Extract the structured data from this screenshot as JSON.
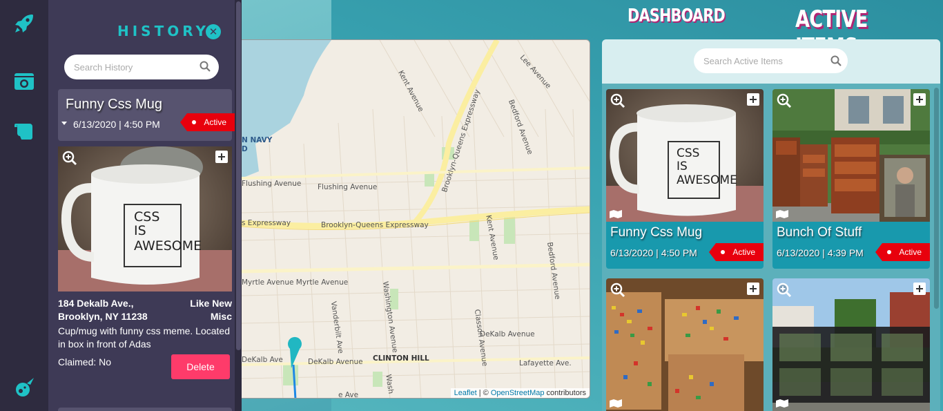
{
  "history": {
    "title": "HISTORY",
    "search_placeholder": "Search History",
    "selected_item": {
      "title": "Funny Css Mug",
      "date": "6/13/2020 | 4:50 PM",
      "status": "Active",
      "address_line1": "184 Dekalb Ave.,",
      "address_line2": "Brooklyn, NY 11238",
      "condition": "Like New",
      "category": "Misc",
      "description": "Cup/mug with funny css meme. Located in box in front of Adas",
      "claimed": "Claimed: No",
      "delete_label": "Delete"
    }
  },
  "header": {
    "dashboard_label": "DASHBOARD",
    "active_items_label": "ACTIVE ITEMS"
  },
  "map": {
    "labels": {
      "kent_avenue": "Kent Avenue",
      "lee_avenue": "Lee Avenue",
      "bedford_avenue": "Bedford Avenue",
      "bqe_diag": "Brooklyn-Queens Expressway",
      "navy_yard_1": "N NAVY",
      "navy_yard_2": "D",
      "flushing_1": "Flushing Avenue",
      "flushing_2": "Flushing Avenue",
      "bqe_1": "s Expressway",
      "bqe_2": "Brooklyn-Queens Expressway",
      "kent_avenue_2": "Kent Avenue",
      "bedford_avenue_2": "Bedford Avenue",
      "myrtle": "Myrtle Avenue Myrtle Avenue",
      "washington": "Washington Avenue",
      "vanderbilt": "Vanderbilt Ave",
      "classon": "Classon Avenue",
      "dekalb_1": "DeKalb Avenue",
      "dekalb_2": "DeKalb Ave",
      "dekalb_3": "DeKalb Avenue",
      "clinton_hill": "CLINTON HILL",
      "lafayette": "Lafayette Ave.",
      "wash_2": "Wash",
      "fragment_1": "e Ave"
    },
    "attribution_leaflet": "Leaflet",
    "attribution_sep": " | © ",
    "attribution_osm": "OpenStreetMap",
    "attribution_tail": " contributors"
  },
  "active_items": {
    "search_placeholder": "Search Active Items",
    "items": [
      {
        "title": "Funny Css Mug",
        "date": "6/13/2020 | 4:50 PM",
        "status": "Active"
      },
      {
        "title": "Bunch Of Stuff",
        "date": "6/13/2020 | 4:39 PM",
        "status": "Active"
      },
      {
        "title": "",
        "date": "",
        "status": ""
      },
      {
        "title": "",
        "date": "",
        "status": ""
      }
    ]
  },
  "mug_text": [
    "CSS",
    "IS",
    "AWESOME"
  ],
  "colors": {
    "accent": "#1fc2c6",
    "tag_red": "#e8000d",
    "delete": "#fe3b6a",
    "header_shadow": "#b02573"
  }
}
